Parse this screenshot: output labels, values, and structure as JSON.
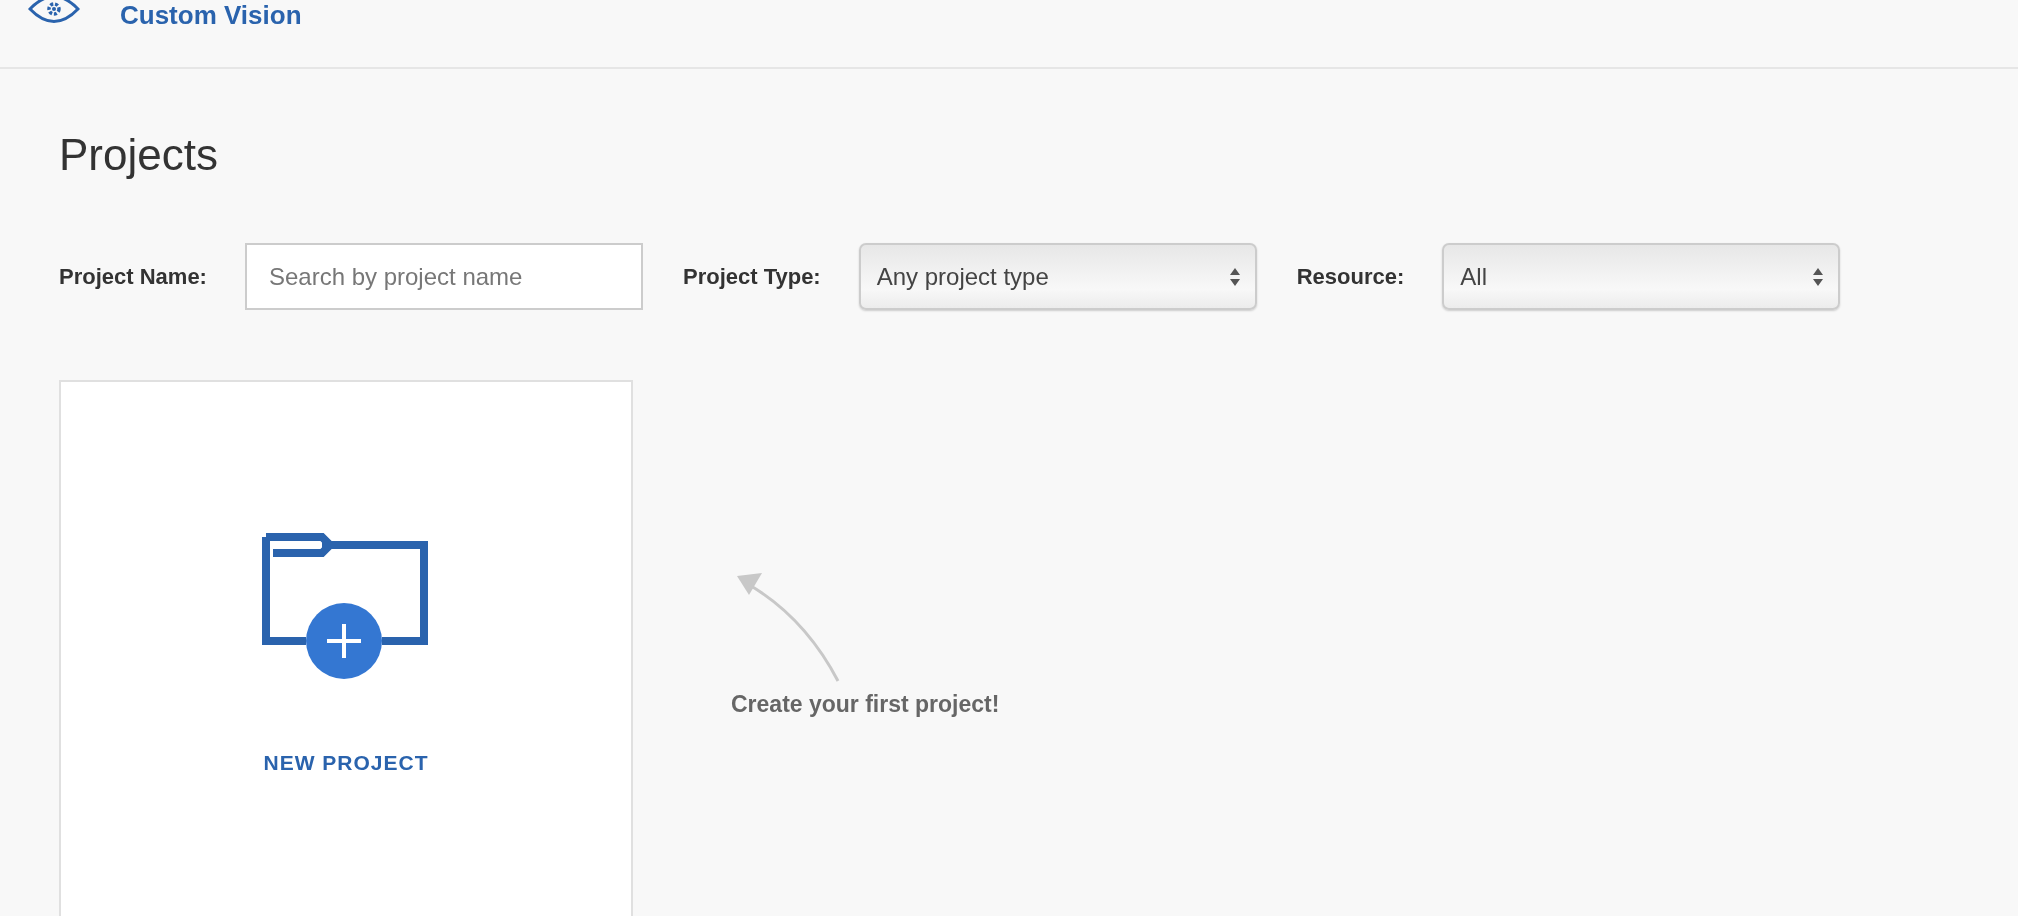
{
  "header": {
    "app_name": "Custom Vision"
  },
  "page_title": "Projects",
  "filters": [
    {
      "label": "Project Name:",
      "kind": "search",
      "placeholder": "Search by project name"
    },
    {
      "label": "Project Type:",
      "kind": "select",
      "value": "Any project type"
    },
    {
      "label": "Resource:",
      "kind": "select",
      "value": "All"
    }
  ],
  "new_project_card": {
    "label": "NEW PROJECT"
  },
  "hint": {
    "text": "Create your first project!"
  }
}
